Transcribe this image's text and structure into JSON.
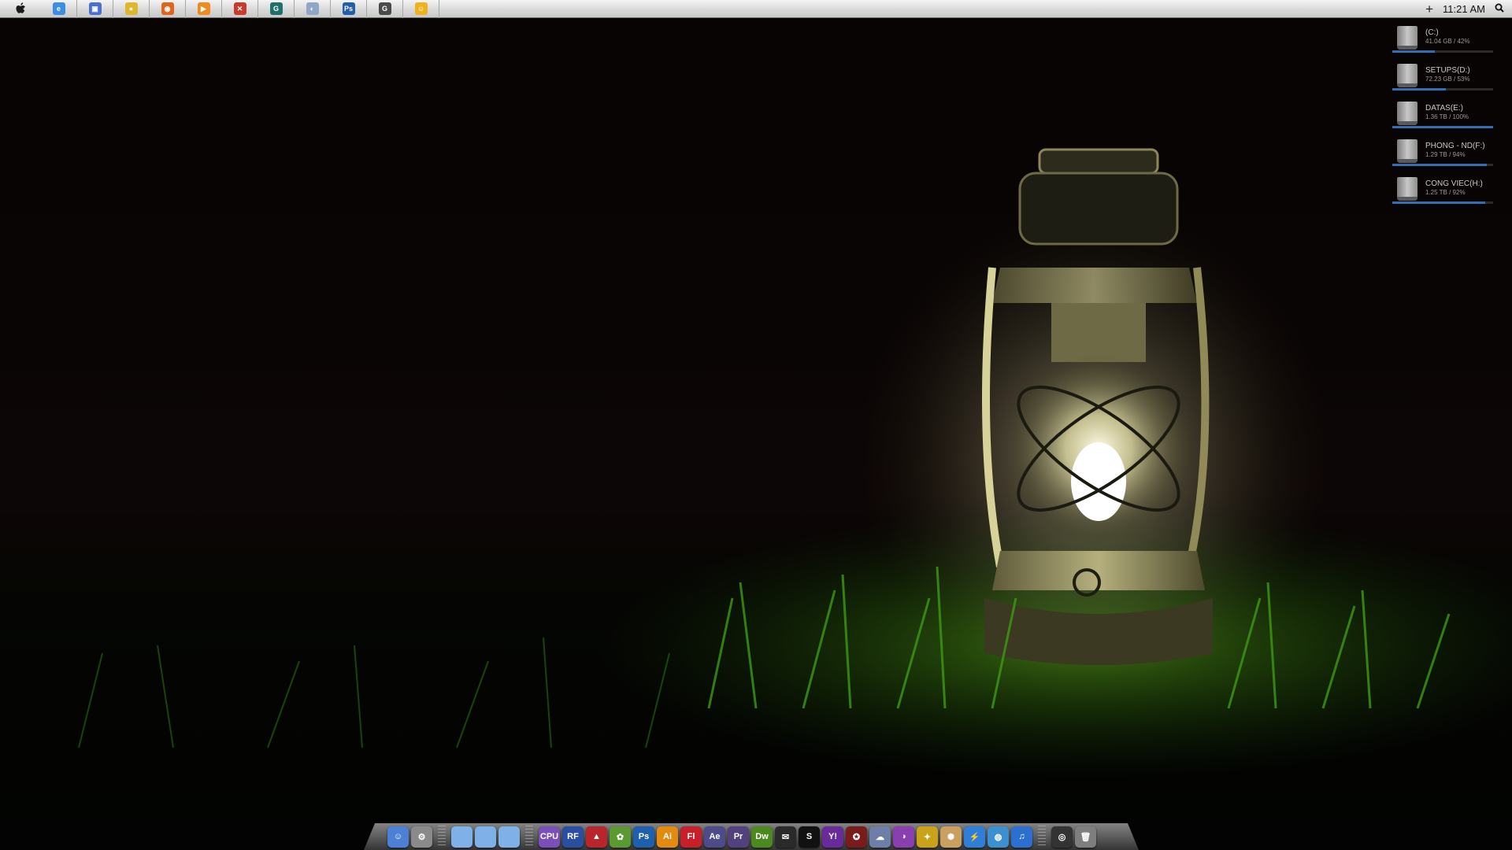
{
  "menubar": {
    "apple_icon": "apple-logo",
    "taskbar": [
      {
        "name": "internet-explorer",
        "glyph": "e",
        "color": "#3a8ee6"
      },
      {
        "name": "desktop-app",
        "glyph": "▣",
        "color": "#4b6fd1"
      },
      {
        "name": "chrome",
        "glyph": "●",
        "color": "#e0b62a"
      },
      {
        "name": "firefox",
        "glyph": "◉",
        "color": "#e0641c"
      },
      {
        "name": "media-player",
        "glyph": "▶",
        "color": "#f08a1c"
      },
      {
        "name": "picture-app",
        "glyph": "✕",
        "color": "#c93a2b"
      },
      {
        "name": "green-app",
        "glyph": "G",
        "color": "#1f6f6b"
      },
      {
        "name": "network-app",
        "glyph": "◐",
        "color": "#8fa6c7"
      },
      {
        "name": "photoshop",
        "glyph": "Ps",
        "color": "#1f5fae"
      },
      {
        "name": "dark-app",
        "glyph": "G",
        "color": "#4a4a4a"
      },
      {
        "name": "yahoo-messenger",
        "glyph": "☺",
        "color": "#f0b21c"
      }
    ],
    "plus": "+",
    "clock": "11:21 AM",
    "search_icon": "magnifier"
  },
  "drives": [
    {
      "name": "(C:)",
      "info": "41.04 GB / 42%",
      "fill": 0.42,
      "icon": "windows-drive"
    },
    {
      "name": "SETUPS(D:)",
      "info": "72.23 GB / 53%",
      "fill": 0.53,
      "icon": "hard-drive"
    },
    {
      "name": "DATAS(E:)",
      "info": "1.36 TB / 100%",
      "fill": 1.0,
      "icon": "hard-drive"
    },
    {
      "name": "PHONG - ND(F:)",
      "info": "1.29 TB / 94%",
      "fill": 0.94,
      "icon": "hard-drive"
    },
    {
      "name": "CONG VIEC(H:)",
      "info": "1.25 TB / 92%",
      "fill": 0.92,
      "icon": "hard-drive"
    }
  ],
  "dock": {
    "group1": [
      {
        "name": "finder",
        "label": "☺",
        "color": "#4d7fd6"
      },
      {
        "name": "system-preferences",
        "label": "⚙",
        "color": "#8a8a8a"
      }
    ],
    "group2": [
      {
        "name": "folder-1",
        "label": "",
        "color": "#7fb0e8"
      },
      {
        "name": "folder-2",
        "label": "",
        "color": "#7fb0e8"
      },
      {
        "name": "folder-3",
        "label": "",
        "color": "#7fb0e8"
      }
    ],
    "group3": [
      {
        "name": "cpu-z",
        "label": "CPU",
        "color": "#7a4fb8"
      },
      {
        "name": "rf-app",
        "label": "RF",
        "color": "#2a4fa0"
      },
      {
        "name": "acrobat",
        "label": "▲",
        "color": "#b8262b"
      },
      {
        "name": "green-leaf-app",
        "label": "✿",
        "color": "#5b9a32"
      },
      {
        "name": "photoshop",
        "label": "Ps",
        "color": "#1e5fae"
      },
      {
        "name": "illustrator",
        "label": "Ai",
        "color": "#e38a10"
      },
      {
        "name": "flash",
        "label": "Fl",
        "color": "#c8202b"
      },
      {
        "name": "after-effects",
        "label": "Ae",
        "color": "#4d4b8a"
      },
      {
        "name": "premiere",
        "label": "Pr",
        "color": "#52417d"
      },
      {
        "name": "dreamweaver",
        "label": "Dw",
        "color": "#4c8a1f"
      },
      {
        "name": "chat-bubble",
        "label": "✉",
        "color": "#2a2a2a"
      },
      {
        "name": "black-app",
        "label": "S",
        "color": "#111111"
      },
      {
        "name": "yahoo-messenger",
        "label": "Y!",
        "color": "#6a2b9a"
      },
      {
        "name": "antivirus",
        "label": "✪",
        "color": "#7a1c1c"
      },
      {
        "name": "cloud-app",
        "label": "☁",
        "color": "#6d7ea8"
      },
      {
        "name": "purple-app",
        "label": "◑",
        "color": "#8a3fb0"
      },
      {
        "name": "bulb-app",
        "label": "✦",
        "color": "#caa21a"
      },
      {
        "name": "film-reel",
        "label": "✺",
        "color": "#c9a060"
      },
      {
        "name": "lightning-app",
        "label": "⚡",
        "color": "#2f7ed8"
      },
      {
        "name": "globe-app",
        "label": "◍",
        "color": "#3c8fd0"
      },
      {
        "name": "itunes",
        "label": "♫",
        "color": "#2d6fcf"
      }
    ],
    "group4": [
      {
        "name": "dashboard",
        "label": "◎",
        "color": "#333333"
      },
      {
        "name": "trash",
        "label": "🗑",
        "color": "#7e7e7e"
      }
    ]
  }
}
